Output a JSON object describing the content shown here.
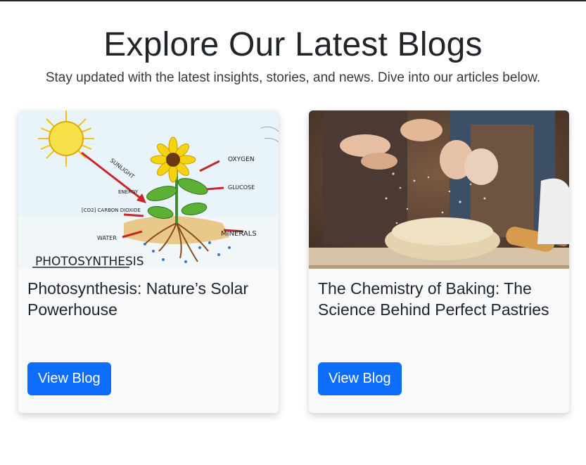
{
  "hero": {
    "title": "Explore Our Latest Blogs",
    "subtitle": "Stay updated with the latest insights, stories, and news. Dive into our articles below."
  },
  "cards": [
    {
      "title": "Photosynthesis: Nature’s Solar Powerhouse",
      "button_label": "View Blog",
      "image": {
        "caption": "PHOTOSYNTHESIS",
        "labels": [
          "SUNLIGHT",
          "ENERGY",
          "OXYGEN",
          "GLUCOSE",
          "[CO2] CARBON DIOXIDE",
          "WATER",
          "MINERALS"
        ]
      }
    },
    {
      "title": "The Chemistry of Baking: The Science Behind Perfect Pastries",
      "button_label": "View Blog"
    }
  ],
  "colors": {
    "accent": "#0d6efd",
    "card_bg": "#f8f9fa",
    "text": "#212529"
  }
}
